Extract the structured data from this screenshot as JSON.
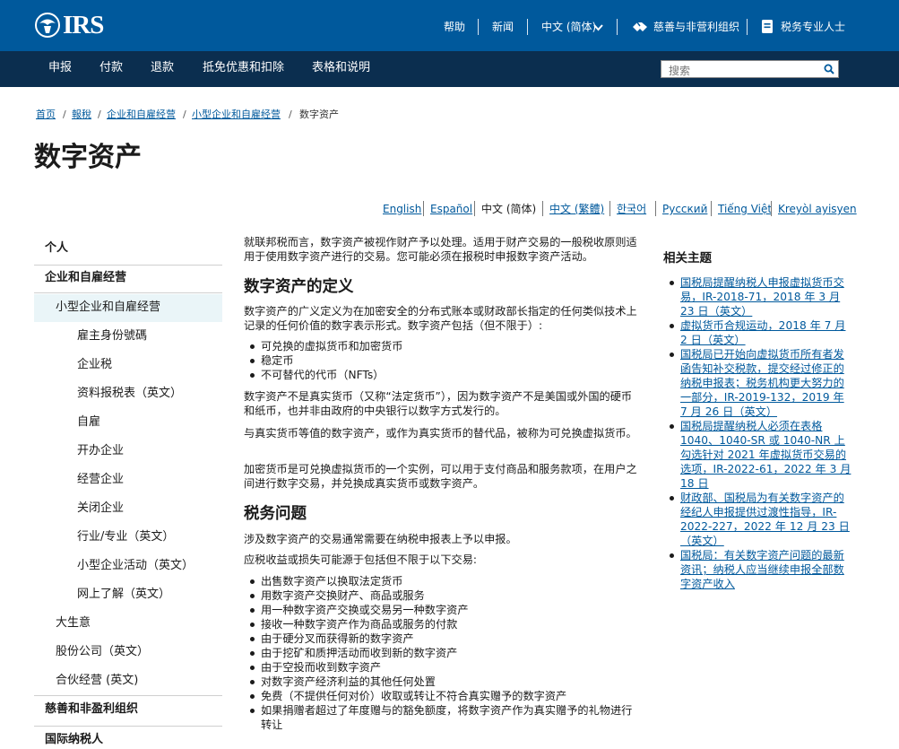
{
  "header": {
    "logo_text": "IRS",
    "links": {
      "help": "帮助",
      "news": "新闻",
      "language": "中文 (简体)",
      "charities": "慈善与非营利组织",
      "tax_pros": "税务专业人士"
    }
  },
  "nav": {
    "items": [
      "申报",
      "付款",
      "退款",
      "抵免优惠和扣除",
      "表格和说明"
    ],
    "search_placeholder": "搜索"
  },
  "breadcrumb": [
    "首页",
    "報稅",
    "企业和自雇经营",
    "小型企业和自雇经营",
    "数字资产"
  ],
  "page_title": "数字资产",
  "languages": [
    "English",
    "Español",
    "中文 (简体)",
    "中文 (繁體)",
    "한국어",
    "Русский",
    "Tiếng Việt",
    "Kreyòl ayisyen"
  ],
  "sidebar": {
    "items": [
      {
        "label": "个人"
      },
      {
        "label": "企业和自雇经营"
      },
      {
        "label": "小型企业和自雇经营"
      },
      {
        "label": "雇主身份號碼"
      },
      {
        "label": "企业税"
      },
      {
        "label": "资料报税表（英文）"
      },
      {
        "label": "自雇"
      },
      {
        "label": "开办企业"
      },
      {
        "label": "经营企业"
      },
      {
        "label": "关闭企业"
      },
      {
        "label": "行业/专业（英文）"
      },
      {
        "label": "小型企业活动（英文）"
      },
      {
        "label": "网上了解（英文）"
      },
      {
        "label": "大生意"
      },
      {
        "label": "股份公司（英文）"
      },
      {
        "label": "合伙经营 (英文)"
      },
      {
        "label": "慈善和非盈利组织"
      },
      {
        "label": "国际纳税人"
      }
    ]
  },
  "main": {
    "intro": "就联邦税而言，数字资产被视作财产予以处理。适用于财产交易的一般税收原则适用于使用数字资产进行的交易。您可能必须在报税时申报数字资产活动。",
    "h2_definition": "数字资产的定义",
    "definition_text": "数字资产的广义定义为在加密安全的分布式账本或财政部长指定的任何类似技术上记录的任何价值的数字表示形式。数字资产包括（但不限于）:",
    "definition_list": [
      "可兑换的虚拟货币和加密货币",
      "稳定币",
      "不可替代的代币（NFTs）"
    ],
    "not_real_currency": "数字资产不是真实货币（又称“法定货币”），因为数字资产不是美国或外国的硬币和纸币，也并非由政府的中央银行以数字方式发行的。",
    "convertible": "与真实货币等值的数字资产，或作为真实货币的替代品，被称为可兑换虚拟货币。",
    "crypto": "加密货币是可兑换虚拟货币的一个实例，可以用于支付商品和服务款项，在用户之间进行数字交易，并兑换成真实货币或数字资产。",
    "h2_tax": "税务问题",
    "tax_p1": "涉及数字资产的交易通常需要在纳税申报表上予以申报。",
    "tax_p2": "应税收益或损失可能源于包括但不限于以下交易:",
    "tax_list": [
      "出售数字资产以换取法定货币",
      "用数字资产交换财产、商品或服务",
      "用一种数字资产交换或交易另一种数字资产",
      "接收一种数字资产作为商品或服务的付款",
      "由于硬分叉而获得新的数字资产",
      "由于挖矿和质押活动而收到新的数字资产",
      "由于空投而收到数字资产",
      "对数字资产经济利益的其他任何处置",
      "免费（不提供任何对价）收取或转让不符合真实赠予的数字资产",
      "如果捐赠者超过了年度赠与的豁免额度，将数字资产作为真实赠予的礼物进行转让"
    ]
  },
  "related": {
    "title": "相关主题",
    "items": [
      "国税局提醒纳税人申报虚拟货币交易，IR-2018-71，2018 年 3 月 23 日（英文）",
      "虚拟货币合规运动，2018 年 7 月 2 日（英文）",
      "国税局已开始向虚拟货币所有者发函告知补交税款，提交经过修正的纳税申报表；税务机构更大努力的一部分，IR-2019-132，2019 年 7 月 26 日（英文）",
      "国税局提醒纳税人必须在表格 1040、1040-SR 或 1040-NR 上勾选针对 2021 年虚拟货币交易的选项，IR-2022-61，2022 年 3 月 18 日",
      "财政部、国税局为有关数字资产的经纪人申报提供过渡性指导，IR-2022-227，2022 年 12 月 23 日（英文）",
      "国税局：有关数字资产问题的最新资讯；纳税人应当继续申报全部数字资产收入"
    ]
  },
  "colors": {
    "top_bar": "#00599c",
    "nav_bar": "#0b2e4f",
    "link": "#00599c",
    "sidebar_active_bg": "#eaf5f8"
  }
}
